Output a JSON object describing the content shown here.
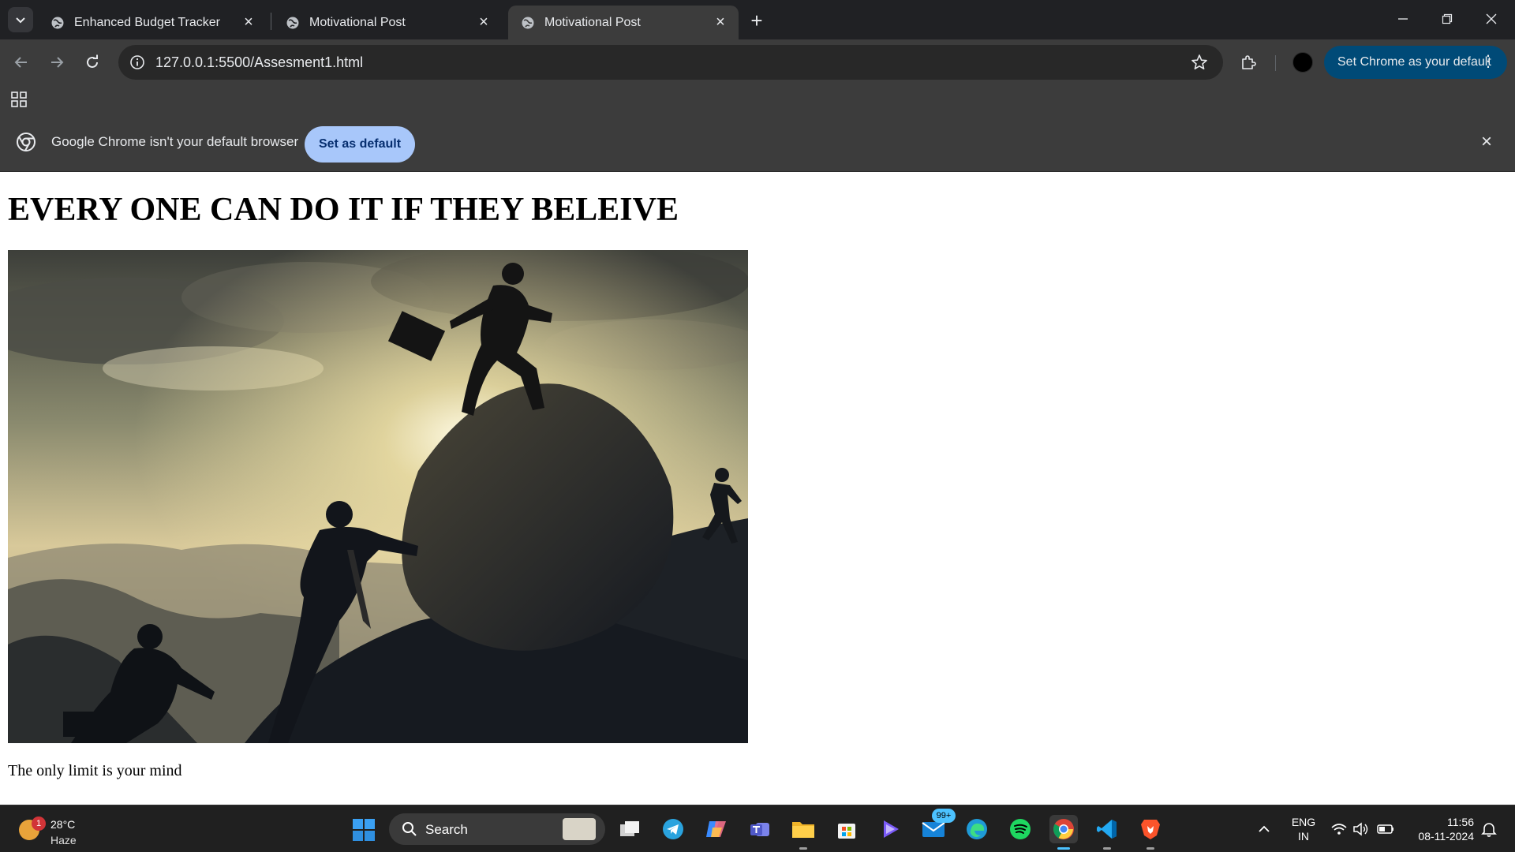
{
  "browser": {
    "tabs": [
      {
        "title": "Enhanced Budget Tracker",
        "active": false
      },
      {
        "title": "Motivational Post",
        "active": false
      },
      {
        "title": "Motivational Post",
        "active": true
      }
    ],
    "url": "127.0.0.1:5500/Assesment1.html",
    "set_default_pill": "Set Chrome as your default",
    "infobar": {
      "message": "Google Chrome isn't your default browser",
      "button": "Set as default"
    }
  },
  "page": {
    "heading": "EVERY ONE CAN DO IT IF THEY BELEIVE",
    "caption": "The only limit is your mind"
  },
  "taskbar": {
    "weather": {
      "temp": "28°C",
      "condition": "Haze",
      "badge": "1"
    },
    "search_label": "Search",
    "mail_badge": "99+",
    "language": {
      "line1": "ENG",
      "line2": "IN"
    },
    "clock": {
      "time": "11:56",
      "date": "08-11-2024"
    }
  }
}
